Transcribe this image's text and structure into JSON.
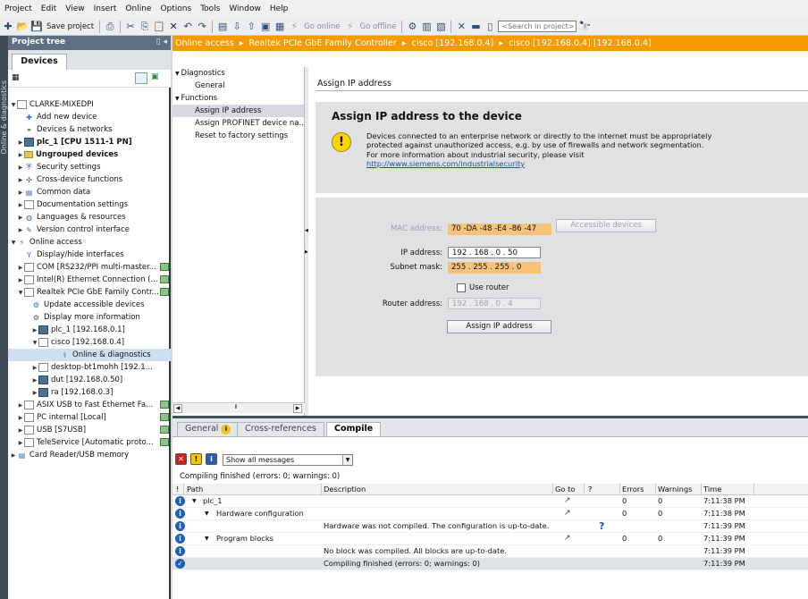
{
  "menu": [
    "Project",
    "Edit",
    "View",
    "Insert",
    "Online",
    "Options",
    "Tools",
    "Window",
    "Help"
  ],
  "toolbar": {
    "save_project": "Save project",
    "go_online": "Go online",
    "go_offline": "Go offline",
    "search_placeholder": "<Search in project>"
  },
  "side_strip": {
    "label": "Online & diagnostics"
  },
  "project_tree": {
    "title": "Project tree",
    "tab": "Devices",
    "items": [
      "CLARKE-MIXEDPI",
      "Add new device",
      "Devices & networks",
      "plc_1 [CPU 1511-1 PN]",
      "Ungrouped devices",
      "Security settings",
      "Cross-device functions",
      "Common data",
      "Documentation settings",
      "Languages & resources",
      "Version control interface",
      "Online access",
      "Display/hide interfaces",
      "COM [RS232/PPI multi-master...",
      "Intel(R) Ethernet Connection (...",
      "Realtek PCIe GbE Family Contr...",
      "Update accessible devices",
      "Display more information",
      "plc_1 [192.168.0.1]",
      "cisco [192.168.0.4]",
      "Online & diagnostics",
      "desktop-bt1mohh [192.1...",
      "dut [192.168.0.50]",
      "ra [192.168.0.3]",
      "ASIX USB to Fast Ethernet Fa...",
      "PC internal [Local]",
      "USB [S7USB]",
      "TeleService [Automatic proto...",
      "Card Reader/USB memory"
    ]
  },
  "breadcrumb": [
    "Online access",
    "Realtek PCIe GbE Family Controller",
    "cisco [192.168.0.4]",
    "cisco [192.168.0.4] [192.168.0.4]"
  ],
  "nav": {
    "diagnostics": "Diagnostics",
    "general": "General",
    "functions": "Functions",
    "assign_ip": "Assign IP address",
    "assign_profinet": "Assign PROFINET device na...",
    "reset_factory": "Reset to factory settings"
  },
  "content": {
    "title": "Assign IP address",
    "heading": "Assign IP address to the device",
    "warning_line1": "Devices connected to an enterprise network or directly to the internet must be appropriately",
    "warning_line2": "protected against unauthorized access, e.g. by use of firewalls and network segmentation.",
    "warning_line3": "For more information about industrial security, please visit",
    "warning_link": "http://www.siemens.com/industrialsecurity",
    "mac_label": "MAC address:",
    "mac_value": "70 -DA -48 -E4 -86 -47",
    "accessible_devices": "Accessible devices",
    "ip_label": "IP address:",
    "ip_value": "192 . 168 . 0   . 50",
    "subnet_label": "Subnet mask:",
    "subnet_value": "255 . 255 . 255 . 0",
    "use_router": "Use router",
    "router_label": "Router address:",
    "router_value": "192 . 168 . 0   . 4",
    "assign_button": "Assign IP address"
  },
  "inspector": {
    "tabs": {
      "general": "General",
      "cross_references": "Cross-references",
      "compile": "Compile"
    },
    "filter": "Show all messages",
    "summary": "Compiling finished (errors: 0; warnings: 0)",
    "columns": {
      "bang": "!",
      "path": "Path",
      "description": "Description",
      "goto": "Go to",
      "q": "?",
      "errors": "Errors",
      "warnings": "Warnings",
      "time": "Time"
    },
    "rows": [
      {
        "path": "plc_1",
        "description": "",
        "errors": "0",
        "warnings": "0",
        "time": "7:11:38 PM"
      },
      {
        "path": "Hardware configuration",
        "description": "",
        "errors": "0",
        "warnings": "0",
        "time": "7:11:38 PM"
      },
      {
        "path": "",
        "description": "Hardware was not compiled. The configuration is up-to-date.",
        "errors": "",
        "warnings": "",
        "time": "7:11:39 PM"
      },
      {
        "path": "Program blocks",
        "description": "",
        "errors": "0",
        "warnings": "0",
        "time": "7:11:39 PM"
      },
      {
        "path": "",
        "description": "No block was compiled. All blocks are up-to-date.",
        "errors": "",
        "warnings": "",
        "time": "7:11:39 PM"
      },
      {
        "path": "",
        "description": "Compiling finished (errors: 0; warnings: 0)",
        "errors": "",
        "warnings": "",
        "time": "7:11:39 PM"
      }
    ]
  }
}
